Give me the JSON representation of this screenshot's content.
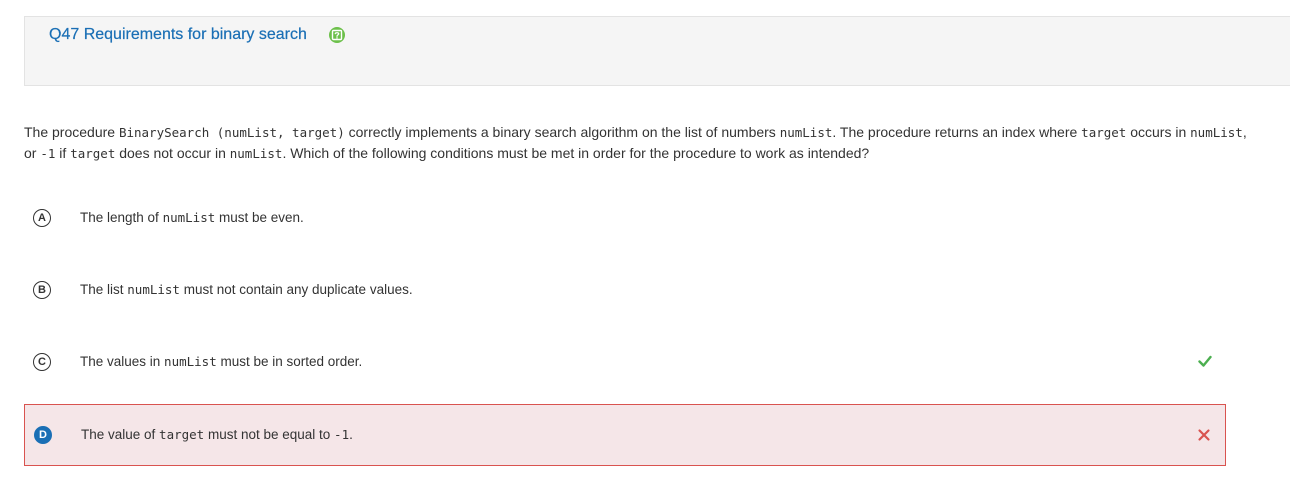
{
  "question": {
    "title": "Q47 Requirements for binary search",
    "help_icon": "help-icon",
    "stem": {
      "p1": "The procedure ",
      "code1": "BinarySearch (numList, target)",
      "p2": " correctly implements a binary search algorithm on the list of numbers ",
      "code2": "numList",
      "p3": ". The procedure returns an index where ",
      "code3": "target",
      "p4": " occurs in ",
      "code4": "numList",
      "p5": ", or ",
      "code5": "-1",
      "p6": " if ",
      "code6": "target",
      "p7": " does not occur in ",
      "code7": "numList",
      "p8": ". Which of the following conditions must be met in order for the procedure to work as intended?"
    }
  },
  "options": [
    {
      "letter": "A",
      "t1": "The length of ",
      "c1": "numList",
      "t2": " must be even.",
      "status": "none"
    },
    {
      "letter": "B",
      "t1": "The list ",
      "c1": "numList",
      "t2": " must not contain any duplicate values.",
      "status": "none"
    },
    {
      "letter": "C",
      "t1": "The values in ",
      "c1": "numList",
      "t2": " must be in sorted order.",
      "status": "correct"
    },
    {
      "letter": "D",
      "t1": "The value of ",
      "c1": "target",
      "t2": " must not be equal to ",
      "c2": "-1",
      "t3": ".",
      "status": "selected-wrong"
    }
  ],
  "colors": {
    "accent": "#1a6fb5",
    "correct": "#4caf50",
    "wrong": "#d9534f",
    "help": "#6cc04a"
  }
}
